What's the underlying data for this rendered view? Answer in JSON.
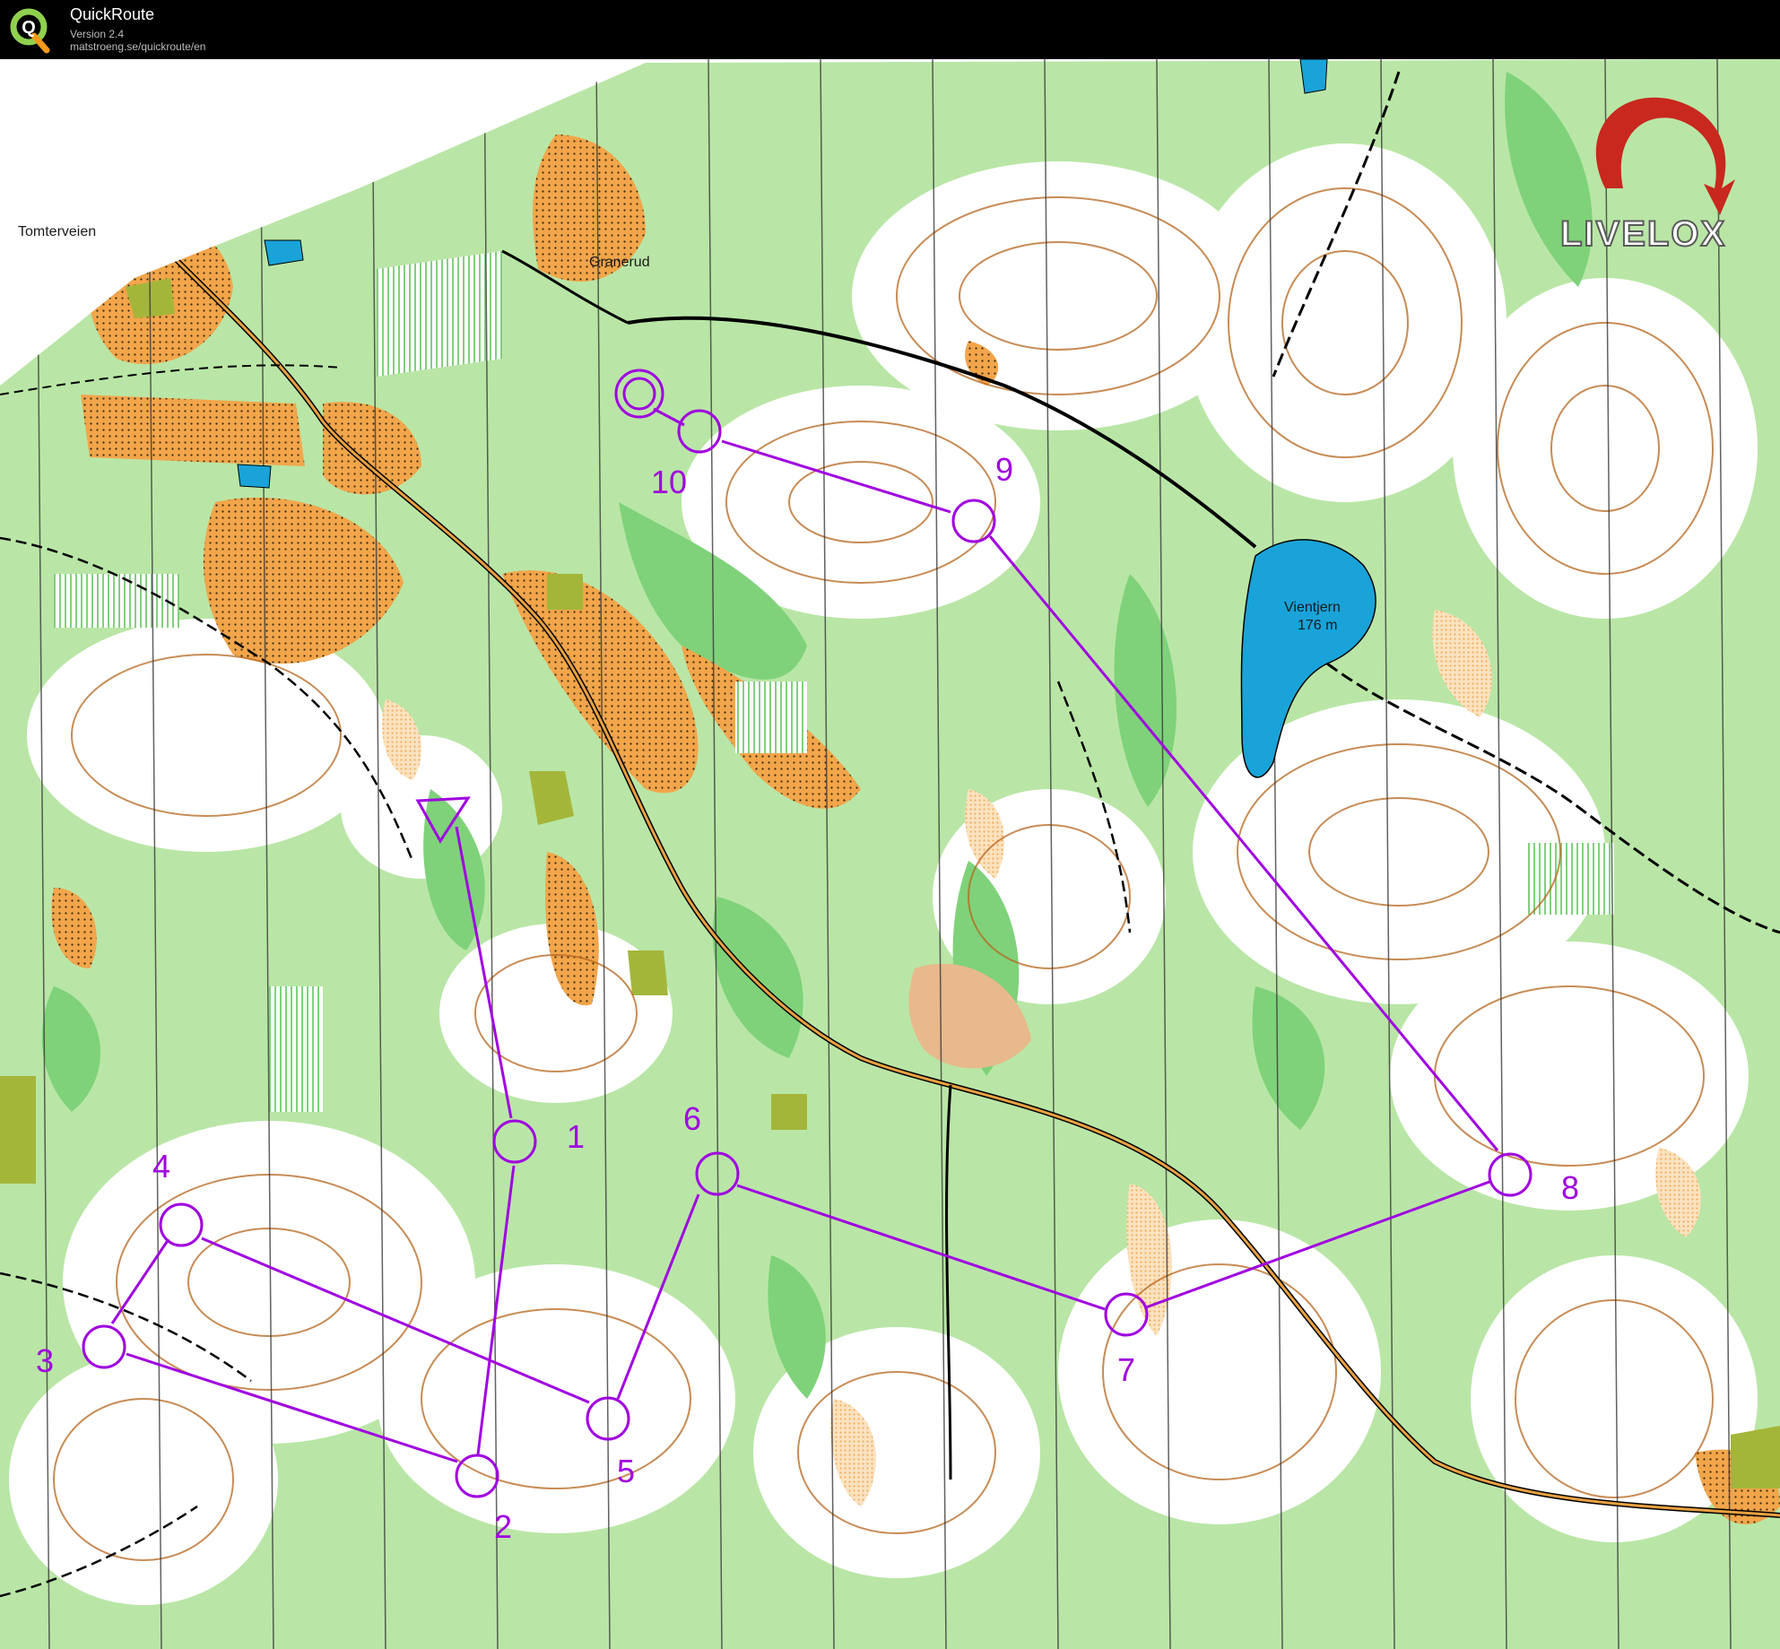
{
  "app": {
    "name": "QuickRoute",
    "version": "Version 2.4",
    "url": "matstroeng.se/quickroute/en",
    "logo_letter": "Q"
  },
  "watermark": {
    "text": "LIVELOX"
  },
  "map": {
    "labels": {
      "tomterveien": "Tomterveien",
      "granerud": "Granerud",
      "vientjern_name": "Vientjern",
      "vientjern_height": "176 m"
    }
  },
  "course": {
    "color": "#a000e0",
    "controls": [
      {
        "id": "1",
        "label": "1"
      },
      {
        "id": "2",
        "label": "2"
      },
      {
        "id": "3",
        "label": "3"
      },
      {
        "id": "4",
        "label": "4"
      },
      {
        "id": "5",
        "label": "5"
      },
      {
        "id": "6",
        "label": "6"
      },
      {
        "id": "7",
        "label": "7"
      },
      {
        "id": "8",
        "label": "8"
      },
      {
        "id": "9",
        "label": "9"
      },
      {
        "id": "10",
        "label": "10"
      }
    ]
  },
  "colors": {
    "forest_green": "#7fd27a",
    "open_yellow": "#f2a54a",
    "water_blue": "#19a3d9",
    "contour_brown": "#b5651d",
    "watermark_red": "#c8281e"
  }
}
